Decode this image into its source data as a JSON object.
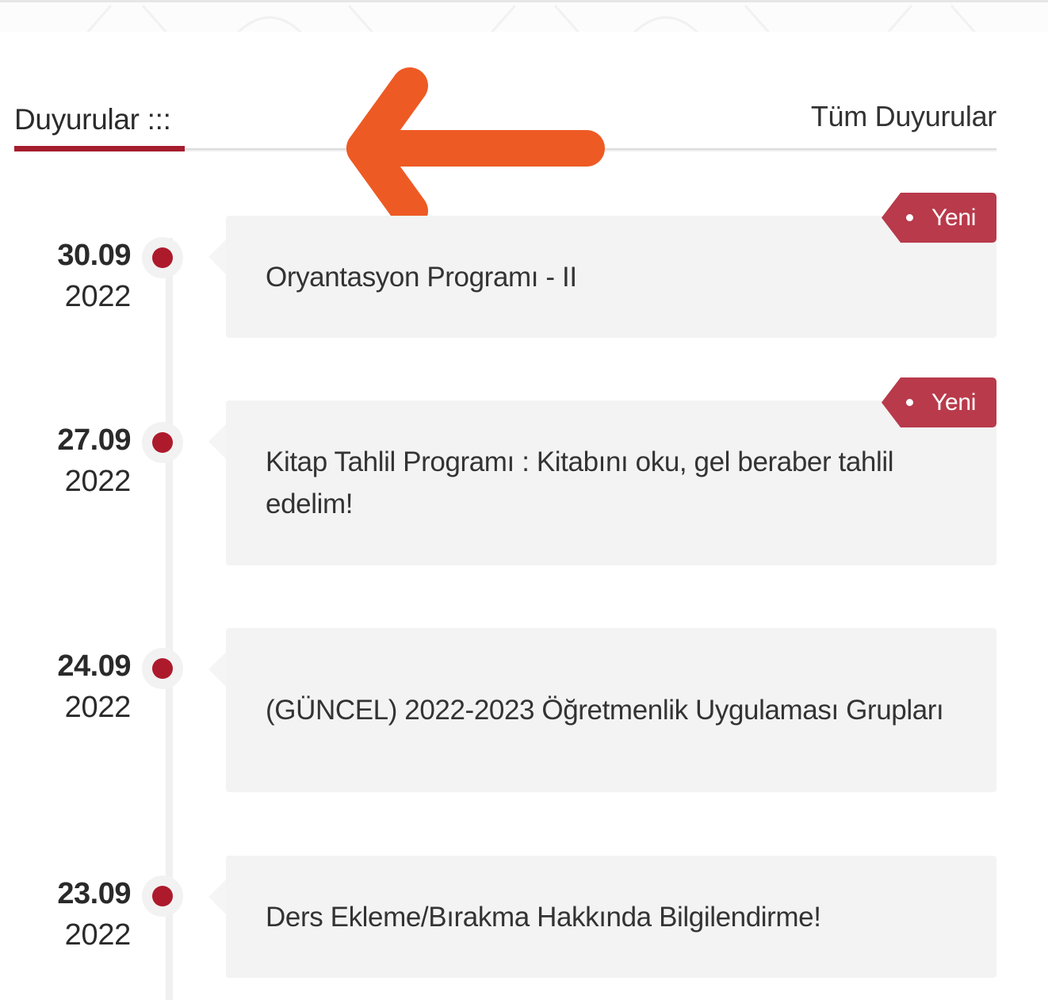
{
  "header": {
    "title": "Duyurular :::",
    "all_link": "Tüm Duyurular"
  },
  "badge_label": "Yeni",
  "colors": {
    "accent": "#a51d2d",
    "dot": "#ad1a2c",
    "badge": "#b83a4b",
    "arrow": "#ee5a24",
    "card": "#f3f3f3"
  },
  "announcements": [
    {
      "day": "30.09",
      "year": "2022",
      "title": "Oryantasyon Programı - II",
      "new": true
    },
    {
      "day": "27.09",
      "year": "2022",
      "title": "Kitap Tahlil Programı : Kitabını oku, gel beraber tahlil edelim!",
      "new": true
    },
    {
      "day": "24.09",
      "year": "2022",
      "title": "(GÜNCEL) 2022-2023 Öğretmenlik Uygulaması Grupları",
      "new": false
    },
    {
      "day": "23.09",
      "year": "2022",
      "title": "Ders Ekleme/Bırakma Hakkında Bilgilendirme!",
      "new": false
    }
  ]
}
